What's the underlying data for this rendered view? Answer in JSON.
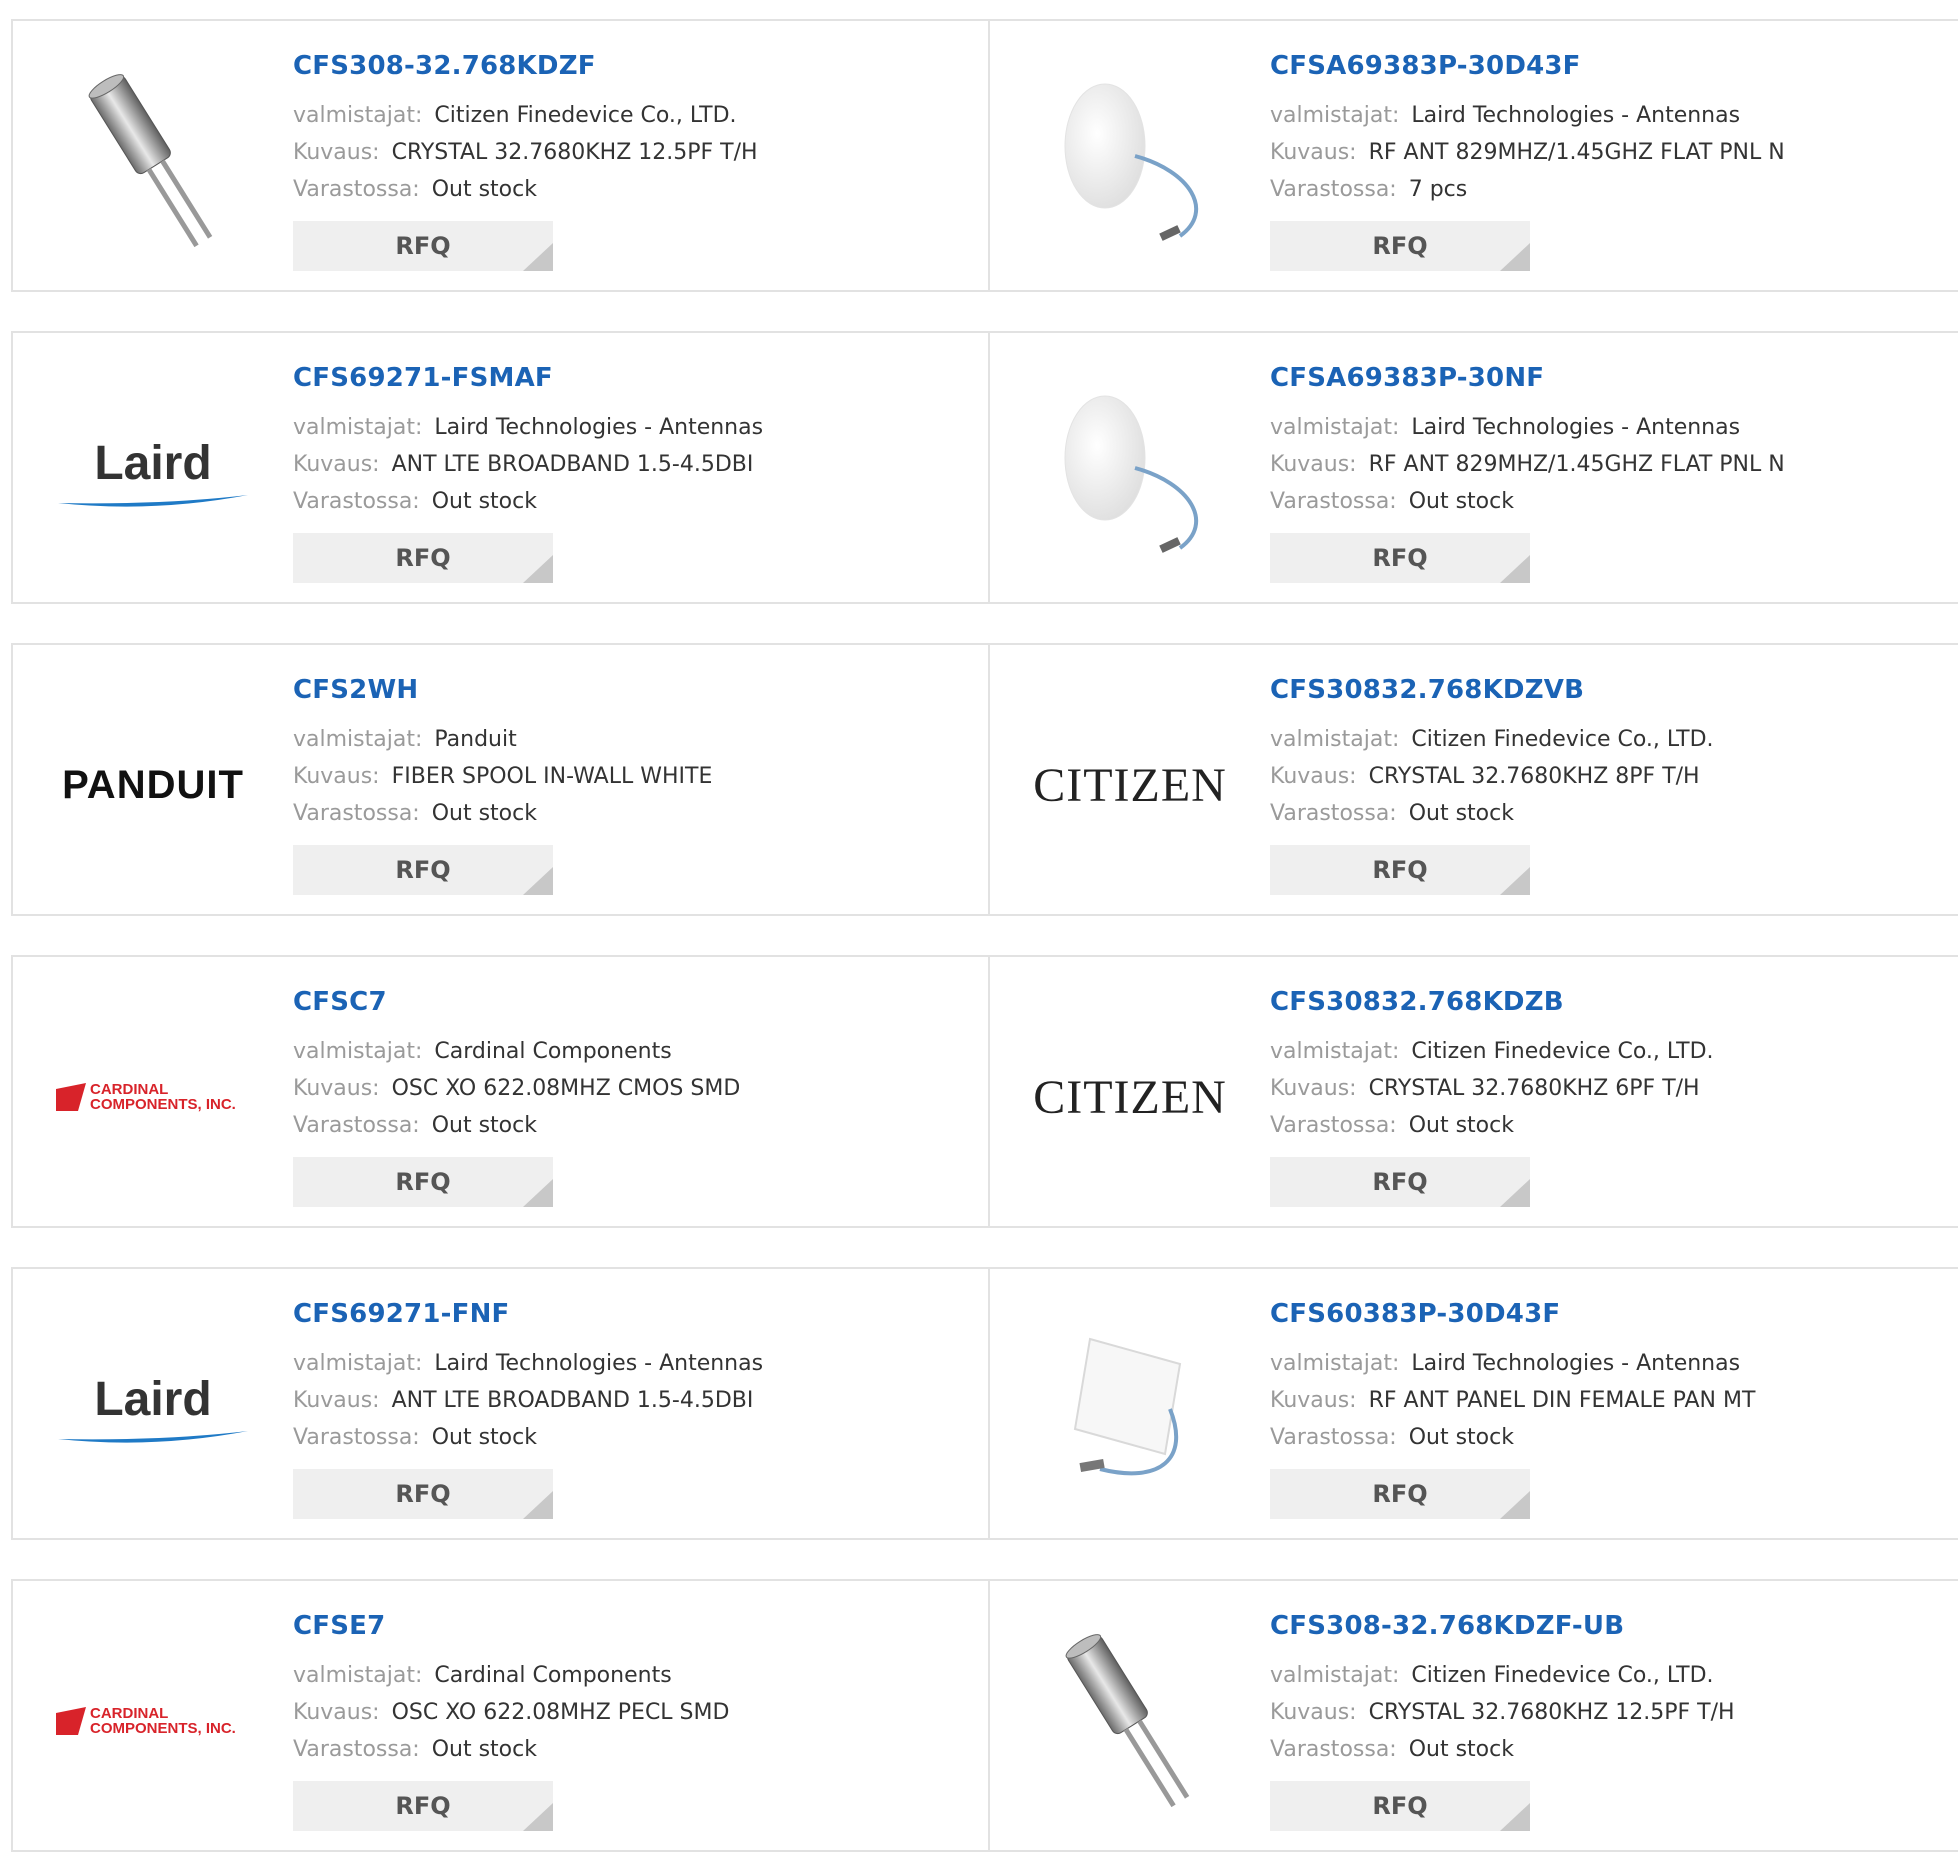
{
  "labels": {
    "manufacturer": "valmistajat:",
    "description": "Kuvaus:",
    "stock": "Varastossa:",
    "rfq": "RFQ"
  },
  "products": [
    {
      "pn": "CFS308-32.768KDZF",
      "manufacturer": "Citizen Finedevice Co., LTD.",
      "description": "CRYSTAL 32.7680KHZ 12.5PF T/H",
      "stock": "Out stock",
      "image": "crystal-can-icon"
    },
    {
      "pn": "CFSA69383P-30D43F",
      "manufacturer": "Laird Technologies - Antennas",
      "description": "RF ANT 829MHZ/1.45GHZ FLAT PNL N",
      "stock": "7 pcs",
      "image": "round-antenna-icon"
    },
    {
      "pn": "CFS69271-FSMAF",
      "manufacturer": "Laird Technologies - Antennas",
      "description": "ANT LTE BROADBAND 1.5-4.5DBI",
      "stock": "Out stock",
      "image": "laird-logo",
      "logo_text": "Laird"
    },
    {
      "pn": "CFSA69383P-30NF",
      "manufacturer": "Laird Technologies - Antennas",
      "description": "RF ANT 829MHZ/1.45GHZ FLAT PNL N",
      "stock": "Out stock",
      "image": "round-antenna-icon"
    },
    {
      "pn": "CFS2WH",
      "manufacturer": "Panduit",
      "description": "FIBER SPOOL IN-WALL WHITE",
      "stock": "Out stock",
      "image": "panduit-logo",
      "logo_text": "PANDUIT"
    },
    {
      "pn": "CFS30832.768KDZVB",
      "manufacturer": "Citizen Finedevice Co., LTD.",
      "description": "CRYSTAL 32.7680KHZ 8PF T/H",
      "stock": "Out stock",
      "image": "citizen-logo",
      "logo_text": "CITIZEN"
    },
    {
      "pn": "CFSC7",
      "manufacturer": "Cardinal Components",
      "description": "OSC XO 622.08MHZ CMOS SMD",
      "stock": "Out stock",
      "image": "cardinal-logo",
      "logo_text": "CARDINAL COMPONENTS, INC."
    },
    {
      "pn": "CFS30832.768KDZB",
      "manufacturer": "Citizen Finedevice Co., LTD.",
      "description": "CRYSTAL 32.7680KHZ 6PF T/H",
      "stock": "Out stock",
      "image": "citizen-logo",
      "logo_text": "CITIZEN"
    },
    {
      "pn": "CFS69271-FNF",
      "manufacturer": "Laird Technologies - Antennas",
      "description": "ANT LTE BROADBAND 1.5-4.5DBI",
      "stock": "Out stock",
      "image": "laird-logo",
      "logo_text": "Laird"
    },
    {
      "pn": "CFS60383P-30D43F",
      "manufacturer": "Laird Technologies - Antennas",
      "description": "RF ANT PANEL DIN FEMALE PAN MT",
      "stock": "Out stock",
      "image": "panel-antenna-icon"
    },
    {
      "pn": "CFSE7",
      "manufacturer": "Cardinal Components",
      "description": "OSC XO 622.08MHZ PECL SMD",
      "stock": "Out stock",
      "image": "cardinal-logo",
      "logo_text": "CARDINAL COMPONENTS, INC."
    },
    {
      "pn": "CFS308-32.768KDZF-UB",
      "manufacturer": "Citizen Finedevice Co., LTD.",
      "description": "CRYSTAL 32.7680KHZ 12.5PF T/H",
      "stock": "Out stock",
      "image": "crystal-can-icon"
    }
  ]
}
